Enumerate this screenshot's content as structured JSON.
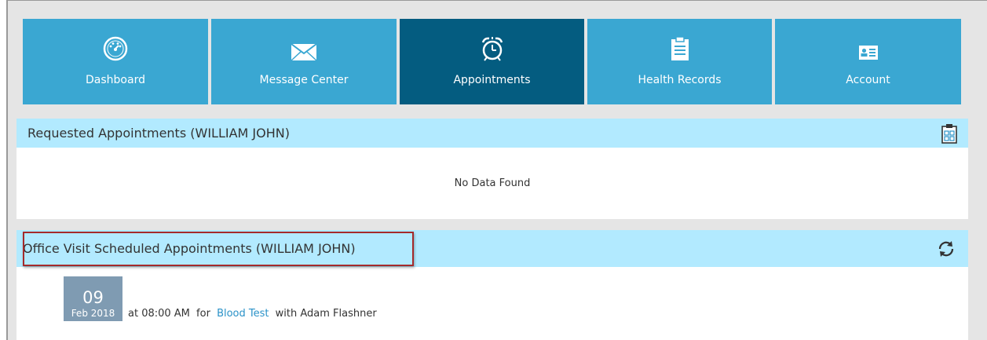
{
  "nav": {
    "tiles": [
      {
        "label": "Dashboard",
        "icon": "dashboard-gauge-icon",
        "active": false
      },
      {
        "label": "Message Center",
        "icon": "envelope-icon",
        "active": false
      },
      {
        "label": "Appointments",
        "icon": "alarm-clock-icon",
        "active": true
      },
      {
        "label": "Health Records",
        "icon": "clipboard-icon",
        "active": false
      },
      {
        "label": "Account",
        "icon": "id-card-icon",
        "active": false
      }
    ]
  },
  "requested": {
    "title": "Requested Appointments (WILLIAM JOHN)",
    "empty_text": "No Data Found",
    "icon": "calendar-clipboard-icon"
  },
  "scheduled": {
    "title": "Office Visit Scheduled Appointments (WILLIAM JOHN)",
    "icon": "refresh-icon",
    "appointment": {
      "day": "09",
      "month_year": "Feb 2018",
      "time_text": "at 08:00 AM",
      "for_text": "for",
      "service": "Blood Test",
      "with_text": "with Adam Flashner"
    }
  },
  "colors": {
    "tile": "#3aa7d2",
    "tile_active": "#045c80",
    "panel_header": "#b2eaff",
    "highlight": "#a52a2a",
    "link": "#2a92c8"
  }
}
